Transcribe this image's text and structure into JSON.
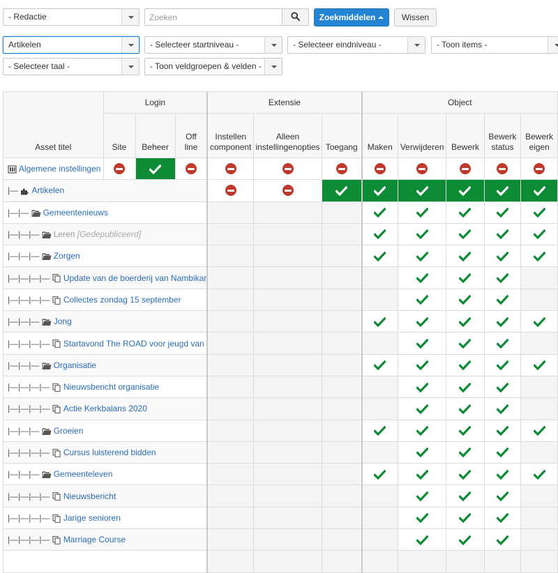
{
  "filters": {
    "context_select": "- Redactie",
    "search_placeholder": "Zoeken",
    "search_tools_label": "Zoekmiddelen",
    "clear_label": "Wissen",
    "component_select": "Artikelen",
    "start_level_select": "- Selecteer startniveau -",
    "end_level_select": "- Selecteer eindniveau -",
    "show_items_select": "- Toon items -",
    "language_select": "- Selecteer taal -",
    "fieldgroups_select": "- Toon veldgroepen & velden -"
  },
  "table": {
    "asset_title_header": "Asset titel",
    "groups": [
      {
        "label": "Login"
      },
      {
        "label": "Extensie"
      },
      {
        "label": "Object"
      }
    ],
    "columns": [
      [
        "Site"
      ],
      [
        "Beheer"
      ],
      [
        "Off",
        "line"
      ],
      [
        "Instellen",
        "component"
      ],
      [
        "Alleen",
        "instellingenopties"
      ],
      [
        "Toegang"
      ],
      [
        "Maken"
      ],
      [
        "Verwijderen"
      ],
      [
        "Bewerk"
      ],
      [
        "Bewerk",
        "status"
      ],
      [
        "Bewerk",
        "eigen"
      ]
    ],
    "rows": [
      {
        "prefix": "",
        "icon": "global-config-icon",
        "title": "Algemene instellingen",
        "unpublished": false,
        "perms": [
          "deny",
          "allow-bg",
          "deny",
          "deny",
          "deny",
          "deny",
          "deny",
          "deny",
          "deny",
          "deny",
          "deny"
        ]
      },
      {
        "prefix": "|— ",
        "icon": "puzzle-icon",
        "title": "Artikelen",
        "unpublished": false,
        "perms": [
          "none",
          "none",
          "none",
          "deny",
          "deny",
          "allow-bg",
          "allow-bg",
          "allow-bg",
          "allow-bg",
          "allow-bg",
          "allow-bg"
        ]
      },
      {
        "prefix": "|—|— ",
        "icon": "folder-icon",
        "title": "Gemeentenieuws",
        "unpublished": false,
        "perms": [
          "x",
          "x",
          "x",
          "grey",
          "grey",
          "grey",
          "allow",
          "allow",
          "allow",
          "allow",
          "allow"
        ]
      },
      {
        "prefix": "|—|—|— ",
        "icon": "folder-icon",
        "title": "Leren",
        "note": "[Gedepubliceerd]",
        "unpublished": true,
        "perms": [
          "x",
          "x",
          "x",
          "grey",
          "grey",
          "grey",
          "allow",
          "allow",
          "allow",
          "allow",
          "allow"
        ]
      },
      {
        "prefix": "|—|—|— ",
        "icon": "folder-icon",
        "title": "Zorgen",
        "unpublished": false,
        "perms": [
          "x",
          "x",
          "x",
          "grey",
          "grey",
          "grey",
          "allow",
          "allow",
          "allow",
          "allow",
          "allow"
        ]
      },
      {
        "prefix": "|—|—|—|— ",
        "icon": "article-icon",
        "title": "Update van de boerderij van Nambikar",
        "unpublished": false,
        "perms": [
          "x",
          "x",
          "x",
          "grey",
          "grey",
          "grey",
          "grey",
          "allow",
          "allow",
          "allow",
          "grey"
        ]
      },
      {
        "prefix": "|—|—|—|— ",
        "icon": "article-icon",
        "title": "Collectes zondag 15 september",
        "unpublished": false,
        "perms": [
          "x",
          "x",
          "x",
          "grey",
          "grey",
          "grey",
          "grey",
          "allow",
          "allow",
          "allow",
          "grey"
        ]
      },
      {
        "prefix": "|—|—|— ",
        "icon": "folder-icon",
        "title": "Jong",
        "unpublished": false,
        "perms": [
          "x",
          "x",
          "x",
          "grey",
          "grey",
          "grey",
          "allow",
          "allow",
          "allow",
          "allow",
          "allow"
        ]
      },
      {
        "prefix": "|—|—|—|— ",
        "icon": "article-icon",
        "title": "Startavond The ROAD voor jeugd van",
        "unpublished": false,
        "perms": [
          "x",
          "x",
          "x",
          "grey",
          "grey",
          "grey",
          "grey",
          "allow",
          "allow",
          "allow",
          "grey"
        ]
      },
      {
        "prefix": "|—|—|— ",
        "icon": "folder-icon",
        "title": "Organisatie",
        "unpublished": false,
        "perms": [
          "x",
          "x",
          "x",
          "grey",
          "grey",
          "grey",
          "allow",
          "allow",
          "allow",
          "allow",
          "allow"
        ]
      },
      {
        "prefix": "|—|—|—|— ",
        "icon": "article-icon",
        "title": "Nieuwsbericht organisatie",
        "unpublished": false,
        "perms": [
          "x",
          "x",
          "x",
          "grey",
          "grey",
          "grey",
          "grey",
          "allow",
          "allow",
          "allow",
          "grey"
        ]
      },
      {
        "prefix": "|—|—|—|— ",
        "icon": "article-icon",
        "title": "Actie Kerkbalans 2020",
        "unpublished": false,
        "perms": [
          "x",
          "x",
          "x",
          "grey",
          "grey",
          "grey",
          "grey",
          "allow",
          "allow",
          "allow",
          "grey"
        ]
      },
      {
        "prefix": "|—|—|— ",
        "icon": "folder-icon",
        "title": "Groeien",
        "unpublished": false,
        "perms": [
          "x",
          "x",
          "x",
          "grey",
          "grey",
          "grey",
          "allow",
          "allow",
          "allow",
          "allow",
          "allow"
        ]
      },
      {
        "prefix": "|—|—|—|— ",
        "icon": "article-icon",
        "title": "Cursus luisterend bidden",
        "unpublished": false,
        "perms": [
          "x",
          "x",
          "x",
          "grey",
          "grey",
          "grey",
          "grey",
          "allow",
          "allow",
          "allow",
          "grey"
        ]
      },
      {
        "prefix": "|—|—|— ",
        "icon": "folder-icon",
        "title": "Gemeenteleven",
        "unpublished": false,
        "perms": [
          "x",
          "x",
          "x",
          "grey",
          "grey",
          "grey",
          "allow",
          "allow",
          "allow",
          "allow",
          "allow"
        ]
      },
      {
        "prefix": "|—|—|—|— ",
        "icon": "article-icon",
        "title": "Nieuwsbericht",
        "unpublished": false,
        "perms": [
          "x",
          "x",
          "x",
          "grey",
          "grey",
          "grey",
          "grey",
          "allow",
          "allow",
          "allow",
          "grey"
        ]
      },
      {
        "prefix": "|—|—|—|— ",
        "icon": "article-icon",
        "title": "Jarige senioren",
        "unpublished": false,
        "perms": [
          "x",
          "x",
          "x",
          "grey",
          "grey",
          "grey",
          "grey",
          "allow",
          "allow",
          "allow",
          "grey"
        ]
      },
      {
        "prefix": "|—|—|—|— ",
        "icon": "article-icon",
        "title": "Marriage Course",
        "unpublished": false,
        "perms": [
          "x",
          "x",
          "x",
          "grey",
          "grey",
          "grey",
          "grey",
          "allow",
          "allow",
          "allow",
          "grey"
        ]
      },
      {
        "prefix": "",
        "icon": "",
        "title": "",
        "unpublished": false,
        "perms": [
          "x",
          "x",
          "x",
          "grey",
          "grey",
          "grey",
          "grey",
          "grey",
          "grey",
          "grey",
          "grey"
        ]
      }
    ]
  },
  "colors": {
    "allow_green": "#0d8a34",
    "allow_bg_check": "#ffffff",
    "deny_red": "#c0392b",
    "primary_blue": "#2384d3",
    "link_blue": "#2a6db5"
  }
}
